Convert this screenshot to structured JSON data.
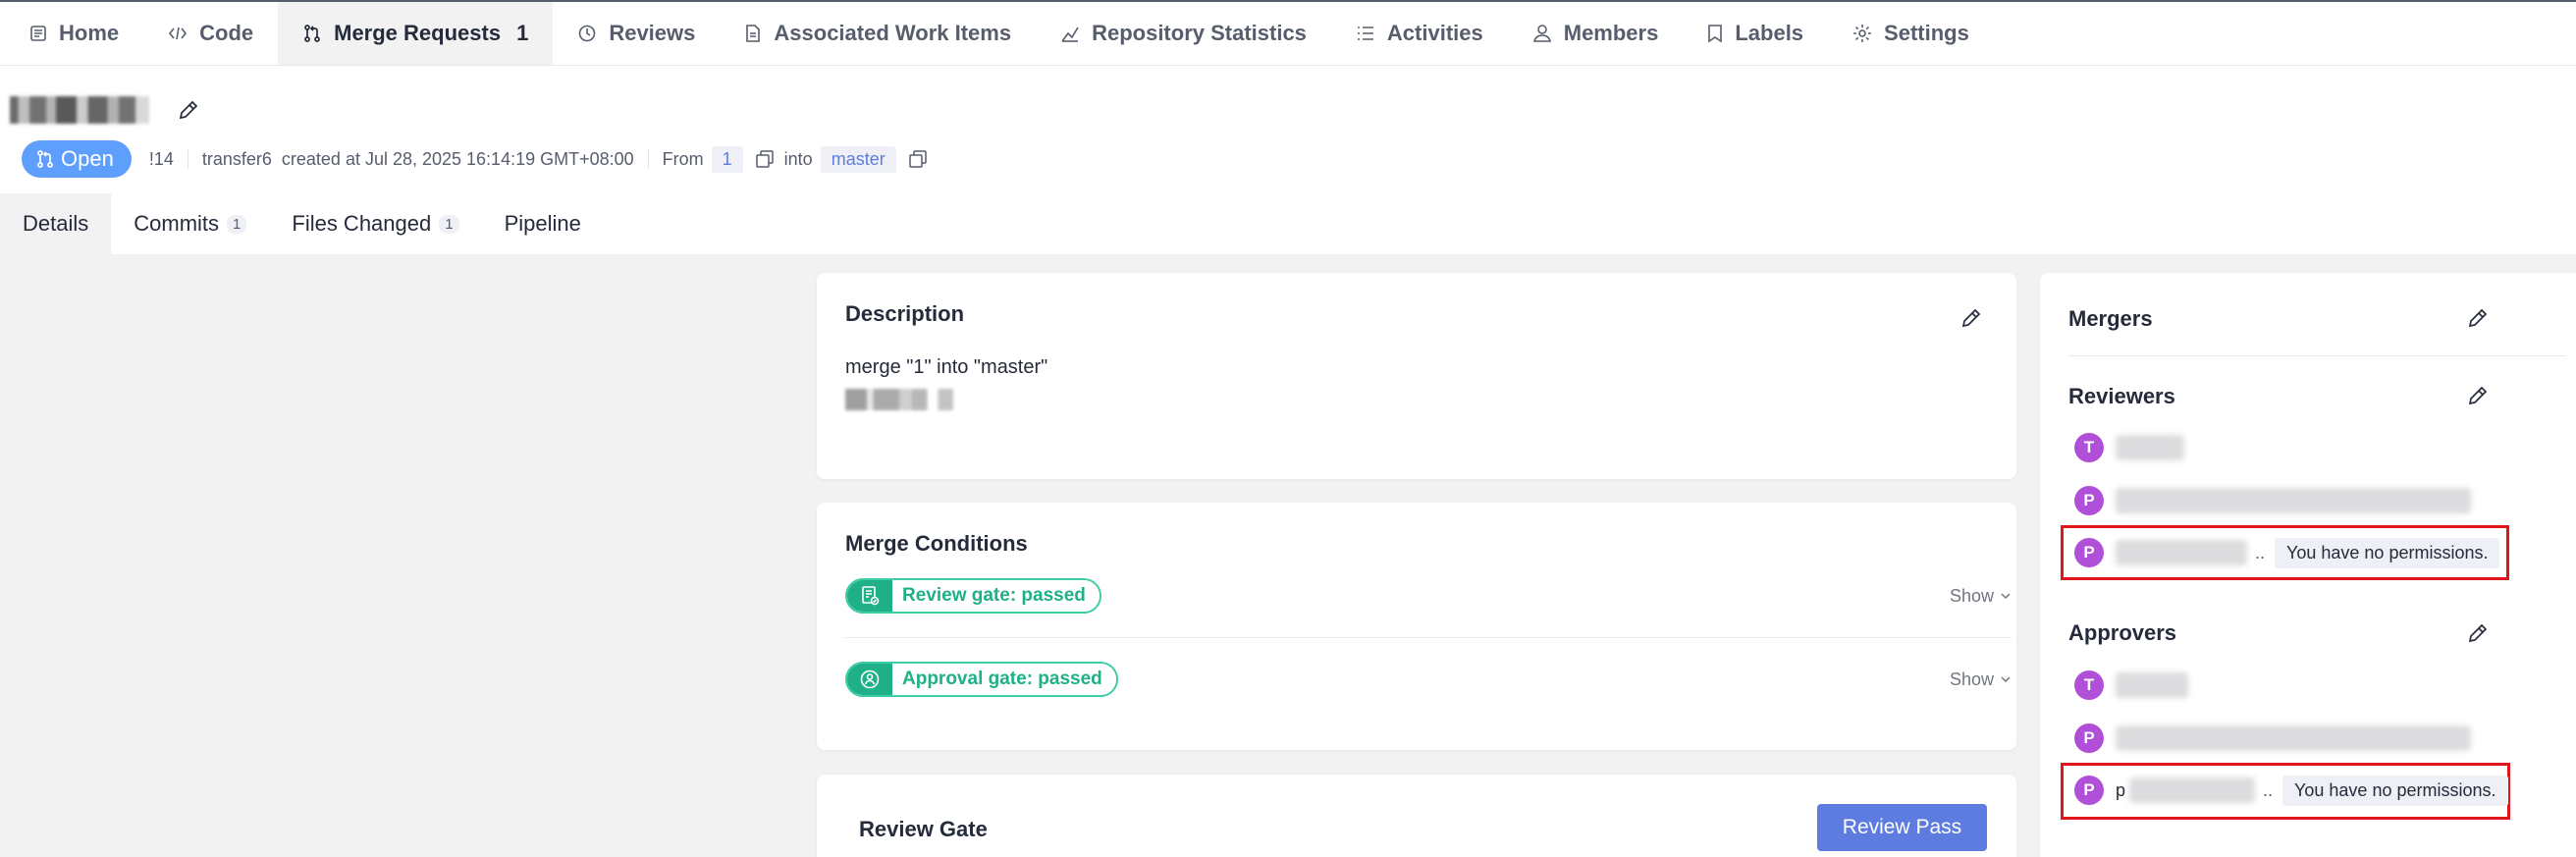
{
  "nav": {
    "items": [
      {
        "label": "Home",
        "icon": "home-doc-icon"
      },
      {
        "label": "Code",
        "icon": "code-icon"
      },
      {
        "label": "Merge Requests",
        "icon": "merge-request-icon",
        "count": "1",
        "active": true
      },
      {
        "label": "Reviews",
        "icon": "review-clock-icon"
      },
      {
        "label": "Associated Work Items",
        "icon": "work-item-icon"
      },
      {
        "label": "Repository Statistics",
        "icon": "stats-chart-icon"
      },
      {
        "label": "Activities",
        "icon": "list-icon"
      },
      {
        "label": "Members",
        "icon": "user-icon"
      },
      {
        "label": "Labels",
        "icon": "bookmark-icon"
      },
      {
        "label": "Settings",
        "icon": "gear-icon"
      }
    ]
  },
  "mr": {
    "status": "Open",
    "id": "!14",
    "author": "transfer6",
    "created": "created at Jul 28, 2025 16:14:19 GMT+08:00",
    "from_label": "From",
    "source_branch": "1",
    "into_label": "into",
    "target_branch": "master"
  },
  "tabs": [
    {
      "label": "Details",
      "active": true
    },
    {
      "label": "Commits",
      "count": "1"
    },
    {
      "label": "Files Changed",
      "count": "1"
    },
    {
      "label": "Pipeline"
    }
  ],
  "description": {
    "title": "Description",
    "text": "merge \"1\" into \"master\""
  },
  "merge_conditions": {
    "title": "Merge Conditions",
    "gates": [
      {
        "label": "Review gate: passed",
        "action": "Show"
      },
      {
        "label": "Approval gate: passed",
        "action": "Show"
      }
    ]
  },
  "review_gate": {
    "title": "Review Gate",
    "button": "Review Pass"
  },
  "sidebar": {
    "mergers_title": "Mergers",
    "reviewers_title": "Reviewers",
    "approvers_title": "Approvers",
    "reviewers": [
      {
        "initial": "T"
      },
      {
        "initial": "P"
      },
      {
        "initial": "P",
        "ellipsis": "..",
        "note": "You have no permissions."
      }
    ],
    "approvers": [
      {
        "initial": "T"
      },
      {
        "initial": "P"
      },
      {
        "initial": "P",
        "name_initial": "p",
        "ellipsis": "..",
        "note": "You have no permissions."
      }
    ]
  },
  "colors": {
    "accent": "#5e7ce0",
    "open_badge": "#5e9ffd",
    "gate_green": "#1fb087",
    "avatar_purple": "#b04fd8",
    "highlight_red": "#e0161b"
  }
}
